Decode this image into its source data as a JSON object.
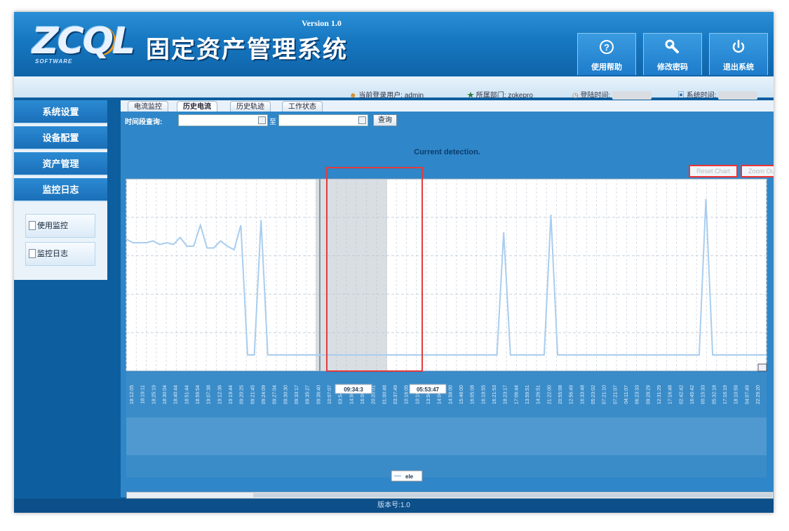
{
  "header": {
    "logo": "ZCQL",
    "logo_sub": "SOFTWARE",
    "title": "固定资产管理系统",
    "version": "Version 1.0",
    "buttons": [
      {
        "label": "使用帮助",
        "icon": "help-icon"
      },
      {
        "label": "修改密码",
        "icon": "wrench-icon"
      },
      {
        "label": "退出系统",
        "icon": "power-icon"
      }
    ]
  },
  "infobar": {
    "user_label": "当前登录用户:",
    "user_value": "admin",
    "dept_label": "所属部门:",
    "dept_value": "zokepro",
    "login_time_label": "登陆时间:",
    "system_time_label": "系统时间:"
  },
  "sidebar": {
    "items": [
      {
        "label": "系统设置"
      },
      {
        "label": "设备配置"
      },
      {
        "label": "资产管理"
      },
      {
        "label": "监控日志"
      }
    ],
    "subitems": [
      {
        "label": "使用监控"
      },
      {
        "label": "监控日志"
      }
    ]
  },
  "tabs": [
    {
      "label": "电流监控",
      "active": false
    },
    {
      "label": "历史电流",
      "active": true
    },
    {
      "label": "历史轨迹",
      "active": false
    },
    {
      "label": "工作状态",
      "active": false
    }
  ],
  "filter": {
    "label": "时间段查询:",
    "to_label": "至",
    "query_label": "查询",
    "start_value": "",
    "end_value": ""
  },
  "chart": {
    "status": "Current detection.",
    "reset_label": "Reset Chart",
    "zoom_label": "Zoom Out",
    "range_start": "09:34:3",
    "range_end": "05:53:47",
    "legend": "ele",
    "series_color": "#a9cdee",
    "highlight_color": "#e33b3b"
  },
  "chart_data": {
    "type": "line",
    "values": [
      72,
      70,
      70,
      70,
      71,
      69,
      70,
      69,
      73,
      68,
      68,
      80,
      67,
      67,
      71,
      68,
      66,
      80,
      6,
      6,
      83,
      6,
      6,
      6,
      6,
      6,
      6,
      6,
      6,
      6,
      6,
      6,
      6,
      6,
      6,
      6,
      6,
      6,
      6,
      6,
      6,
      6,
      6,
      6,
      6,
      6,
      6,
      6,
      6,
      6,
      6,
      6,
      6,
      6,
      6,
      6,
      6,
      6,
      6,
      6,
      6,
      6,
      6,
      6,
      6,
      6,
      6,
      6,
      6,
      6,
      6,
      6,
      6,
      6,
      6,
      6,
      6,
      6,
      6,
      6,
      6,
      6,
      6,
      6,
      6,
      6,
      6,
      6,
      6,
      6,
      6,
      6,
      6,
      6,
      6,
      6
    ],
    "x": [
      "18:12:05",
      "18:19:11",
      "18:25:19",
      "18:30:04",
      "18:40:44",
      "18:51:44",
      "18:59:54",
      "19:07:38",
      "19:12:36",
      "19:19:44",
      "09:20:25",
      "09:21:45",
      "09:24:09",
      "09:27:04",
      "09:30:30",
      "09:33:17",
      "09:35:27",
      "09:36:40",
      "10:07:07",
      "03:54:45",
      "14:50:31",
      "16:00:06",
      "20:20:01",
      "01:00:48",
      "03:37:49",
      "10:16:05",
      "10:16:57",
      "13:56:49",
      "14:06:23",
      "14:58:00",
      "15:48:00",
      "16:05:08",
      "16:18:55",
      "16:21:53",
      "18:23:17",
      "17:06:44",
      "13:59:51",
      "14:26:51",
      "21:22:00",
      "20:55:08",
      "12:56:49",
      "16:33:48",
      "05:23:02",
      "07:21:10",
      "07:21:07",
      "04:11:07",
      "06:23:33",
      "09:28:29",
      "12:31:29",
      "17:16:48",
      "02:42:42",
      "16:45:42",
      "00:15:33",
      "05:32:18",
      "17:16:19",
      "18:10:59",
      "04:07:49",
      "22:29:20"
    ],
    "xlabel": "",
    "ylabel": "",
    "grid": true
  },
  "footer": {
    "version_text": "版本号:1.0"
  }
}
